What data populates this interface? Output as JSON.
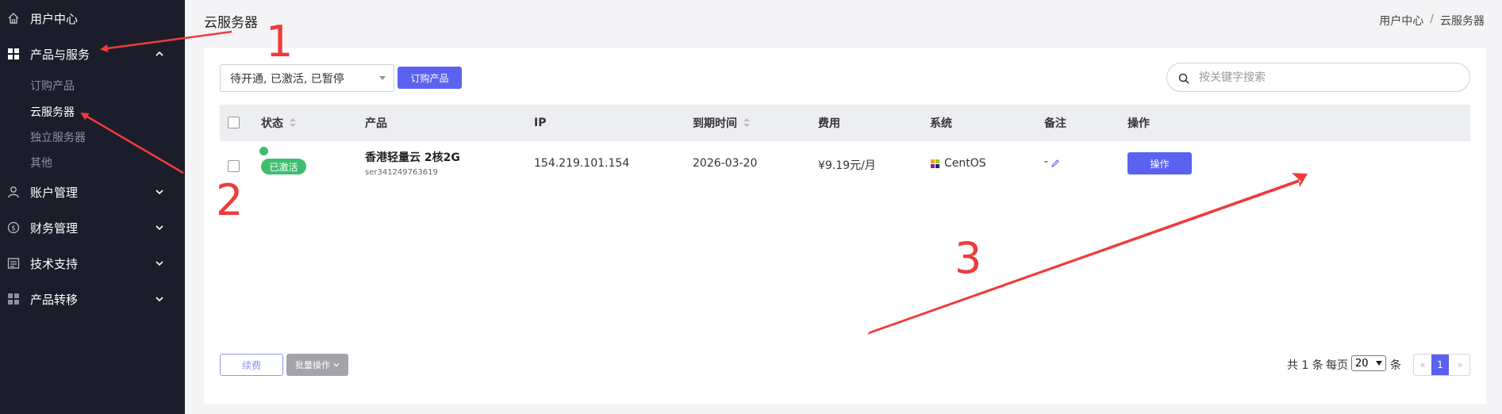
{
  "sidebar": {
    "items": [
      {
        "label": "用户中心",
        "icon": "home-icon"
      },
      {
        "label": "产品与服务",
        "icon": "grid-icon",
        "expanded": true
      },
      {
        "label": "账户管理",
        "icon": "user-icon"
      },
      {
        "label": "财务管理",
        "icon": "dollar-icon"
      },
      {
        "label": "技术支持",
        "icon": "ticket-icon"
      },
      {
        "label": "产品转移",
        "icon": "grid-icon"
      }
    ],
    "sub_items": [
      "订购产品",
      "云服务器",
      "独立服务器",
      "其他"
    ],
    "active_sub": "云服务器"
  },
  "header": {
    "title": "云服务器",
    "breadcrumb": [
      "用户中心",
      "/",
      "云服务器"
    ]
  },
  "toolbar": {
    "status_filter": "待开通, 已激活, 已暂停",
    "order_button": "订购产品",
    "search_placeholder": "按关键字搜索"
  },
  "table": {
    "headers": [
      "状态",
      "产品",
      "IP",
      "到期时间",
      "费用",
      "系统",
      "备注",
      "操作"
    ],
    "rows": [
      {
        "status": "已激活",
        "product_name": "香港轻量云 2核2G",
        "product_id": "ser341249763619",
        "ip": "154.219.101.154",
        "expires": "2026-03-20",
        "price": "¥9.19元/月",
        "os": "CentOS",
        "note": "-",
        "action": "操作"
      }
    ]
  },
  "footer": {
    "renew_button": "续费",
    "batch_button": "批量操作",
    "total_text": "共 1 条",
    "per_page_label": "每页",
    "per_page_value": "20",
    "per_page_unit": "条",
    "prev": "«",
    "current_page": "1",
    "next": "»"
  },
  "annotations": [
    "1",
    "2",
    "3"
  ],
  "colors": {
    "sidebar_bg": "#1c1d2b",
    "primary": "#5b62f0",
    "success": "#3fbd6f",
    "annotation": "#ef3b3b"
  }
}
